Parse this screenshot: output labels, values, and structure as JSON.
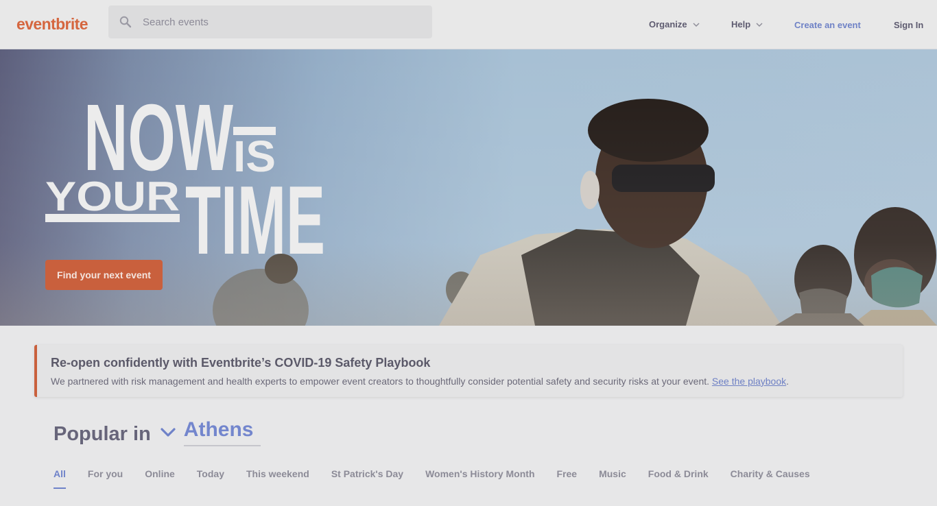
{
  "brand": {
    "logo_text": "eventbrite",
    "accent": "#d5663f",
    "link": "#6e80c4"
  },
  "search": {
    "placeholder": "Search events",
    "icon": "search-icon"
  },
  "nav": {
    "organize": "Organize",
    "help": "Help",
    "create": "Create an event",
    "signin": "Sign In"
  },
  "hero": {
    "headline_line1": "NOW",
    "headline_is": "IS",
    "headline_your": "YOUR",
    "headline_time": "TIME",
    "cta": "Find your next event"
  },
  "notice": {
    "title": "Re-open confidently with Eventbrite’s COVID-19 Safety Playbook",
    "body": "We partnered with risk management and health experts to empower event creators to thoughtfully consider potential safety and security risks at your event. ",
    "link": "See the playbook",
    "end": "."
  },
  "popular": {
    "label": "Popular in",
    "city": "Athens"
  },
  "tabs": [
    "All",
    "For you",
    "Online",
    "Today",
    "This weekend",
    "St Patrick's Day",
    "Women's History Month",
    "Free",
    "Music",
    "Food & Drink",
    "Charity & Causes"
  ]
}
